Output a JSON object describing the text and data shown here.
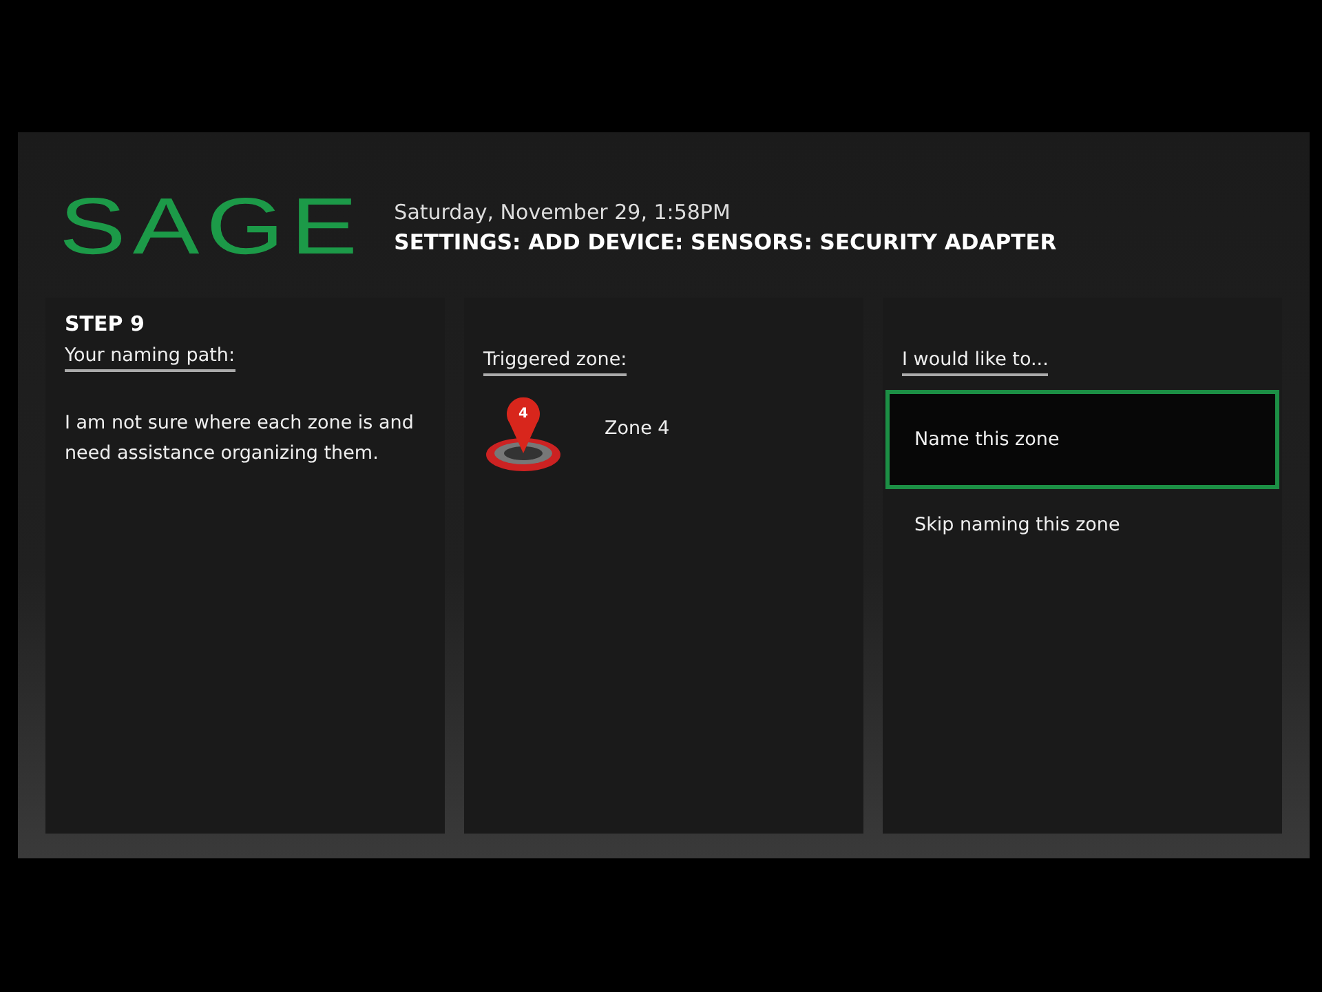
{
  "header": {
    "logo": "SAGE",
    "datetime": "Saturday, November 29, 1:58PM",
    "breadcrumb": "SETTINGS: ADD DEVICE: SENSORS: SECURITY ADAPTER"
  },
  "panels": [
    {
      "kind": "path",
      "step": "STEP 9",
      "heading": "Your naming path:",
      "body": "I am not sure where each zone is and need assistance organizing them."
    },
    {
      "kind": "zone",
      "heading": "Triggered zone:",
      "pin_label": "4",
      "zone": "Zone 4"
    },
    {
      "kind": "options",
      "heading": "I would like to...",
      "options": [
        {
          "label": "Name this zone",
          "selected": true
        },
        {
          "label": "Skip naming this zone",
          "selected": false
        }
      ]
    }
  ]
}
